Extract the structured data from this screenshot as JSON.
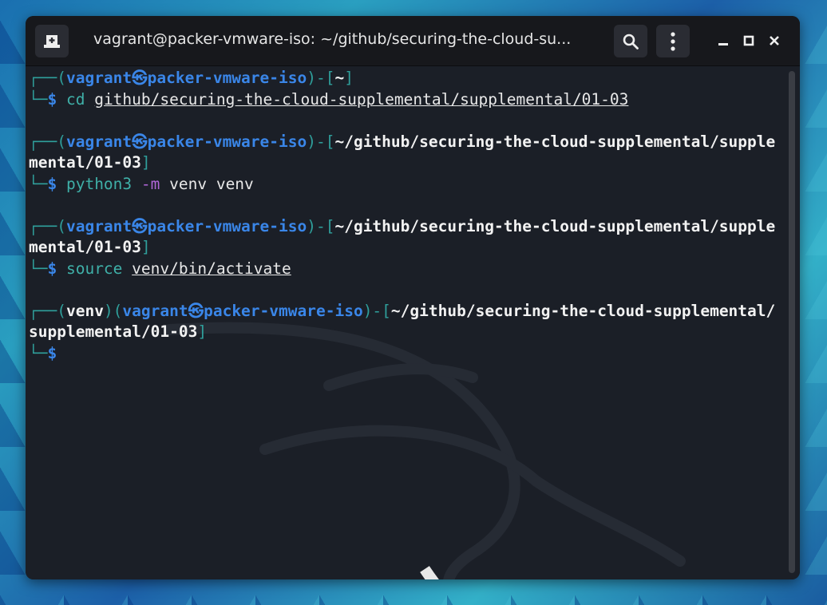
{
  "window": {
    "title": "vagrant@packer-vmware-iso: ~/github/securing-the-cloud-su...",
    "icons": {
      "new_tab": "new-tab-icon",
      "search": "search-icon",
      "menu": "kebab-menu-icon",
      "minimize": "minimize-icon",
      "maximize": "maximize-icon",
      "close": "close-icon"
    }
  },
  "colors": {
    "user_host": "#3a86e8",
    "frame": "#2f9f9b",
    "command": "#3fb0a8",
    "flag": "#b066d8",
    "background": "#1b1f27"
  },
  "terminal": {
    "lines": [
      [
        {
          "t": "┌──(",
          "s": "frame"
        },
        {
          "t": "vagrant㉿packer-vmware-iso",
          "s": "user"
        },
        {
          "t": ")-[",
          "s": "frame"
        },
        {
          "t": "~",
          "s": "path"
        },
        {
          "t": "]",
          "s": "frame"
        }
      ],
      [
        {
          "t": "└─",
          "s": "frame"
        },
        {
          "t": "$ ",
          "s": "prompt"
        },
        {
          "t": "cd ",
          "s": "cmd"
        },
        {
          "t": "github/securing-the-cloud-supplemental/supplemental/01-03",
          "s": "argu"
        }
      ],
      [],
      [
        {
          "t": "┌──(",
          "s": "frame"
        },
        {
          "t": "vagrant㉿packer-vmware-iso",
          "s": "user"
        },
        {
          "t": ")-[",
          "s": "frame"
        },
        {
          "t": "~/github/securing-the-cloud-supplemental/supple",
          "s": "path"
        }
      ],
      [
        {
          "t": "mental/01-03",
          "s": "path"
        },
        {
          "t": "]",
          "s": "frame"
        }
      ],
      [
        {
          "t": "└─",
          "s": "frame"
        },
        {
          "t": "$ ",
          "s": "prompt"
        },
        {
          "t": "python3 ",
          "s": "cmd"
        },
        {
          "t": "-m ",
          "s": "flag"
        },
        {
          "t": "venv venv",
          "s": "arg"
        }
      ],
      [],
      [
        {
          "t": "┌──(",
          "s": "frame"
        },
        {
          "t": "vagrant㉿packer-vmware-iso",
          "s": "user"
        },
        {
          "t": ")-[",
          "s": "frame"
        },
        {
          "t": "~/github/securing-the-cloud-supplemental/supple",
          "s": "path"
        }
      ],
      [
        {
          "t": "mental/01-03",
          "s": "path"
        },
        {
          "t": "]",
          "s": "frame"
        }
      ],
      [
        {
          "t": "└─",
          "s": "frame"
        },
        {
          "t": "$ ",
          "s": "prompt"
        },
        {
          "t": "source ",
          "s": "cmd"
        },
        {
          "t": "venv/bin/activate",
          "s": "argu"
        }
      ],
      [],
      [
        {
          "t": "┌──(",
          "s": "frame"
        },
        {
          "t": "venv",
          "s": "venv"
        },
        {
          "t": ")(",
          "s": "frame"
        },
        {
          "t": "vagrant㉿packer-vmware-iso",
          "s": "user"
        },
        {
          "t": ")-[",
          "s": "frame"
        },
        {
          "t": "~/github/securing-the-cloud-supplemental/",
          "s": "path"
        }
      ],
      [
        {
          "t": "supplemental/01-03",
          "s": "path"
        },
        {
          "t": "]",
          "s": "frame"
        }
      ],
      [
        {
          "t": "└─",
          "s": "frame"
        },
        {
          "t": "$",
          "s": "prompt"
        }
      ]
    ]
  }
}
